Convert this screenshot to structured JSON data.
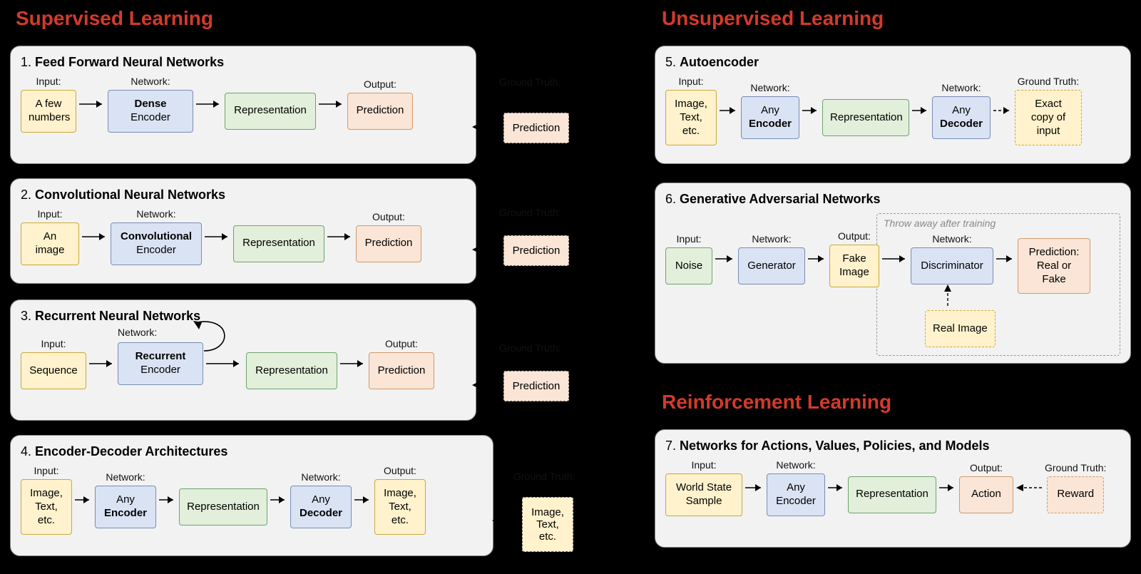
{
  "sections": {
    "supervised": "Supervised Learning",
    "unsupervised": "Unsupervised Learning",
    "reinforcement": "Reinforcement Learning"
  },
  "labels": {
    "input": "Input:",
    "network": "Network:",
    "output": "Output:",
    "ground_truth": "Ground Truth:"
  },
  "panels": {
    "ffnn": {
      "num": "1.",
      "name": "Feed Forward Neural Networks",
      "input": "A few numbers",
      "encoder_top": "Dense",
      "encoder_bot": "Encoder",
      "repr": "Representation",
      "pred": "Prediction",
      "gt": "Prediction"
    },
    "cnn": {
      "num": "2.",
      "name": "Convolutional Neural Networks",
      "input": "An image",
      "encoder_top": "Convolutional",
      "encoder_bot": "Encoder",
      "repr": "Representation",
      "pred": "Prediction",
      "gt": "Prediction"
    },
    "rnn": {
      "num": "3.",
      "name": "Recurrent Neural Networks",
      "input": "Sequence",
      "encoder_top": "Recurrent",
      "encoder_bot": "Encoder",
      "repr": "Representation",
      "pred": "Prediction",
      "gt": "Prediction"
    },
    "encdec": {
      "num": "4.",
      "name": "Encoder-Decoder Architectures",
      "input": "Image, Text, etc.",
      "encoder_top": "Any",
      "encoder_bot": "Encoder",
      "repr": "Representation",
      "decoder_top": "Any",
      "decoder_bot": "Decoder",
      "output": "Image, Text, etc.",
      "gt": "Image, Text, etc."
    },
    "ae": {
      "num": "5.",
      "name": "Autoencoder",
      "input": "Image, Text, etc.",
      "encoder_top": "Any",
      "encoder_bot": "Encoder",
      "repr": "Representation",
      "decoder_top": "Any",
      "decoder_bot": "Decoder",
      "gt": "Exact copy of input"
    },
    "gan": {
      "num": "6.",
      "name": "Generative Adversarial Networks",
      "noise": "Noise",
      "generator": "Generator",
      "fake": "Fake Image",
      "discriminator": "Discriminator",
      "pred": "Prediction: Real or Fake",
      "real": "Real Image",
      "discard": "Throw away after training"
    },
    "rl": {
      "num": "7.",
      "name": "Networks for Actions, Values, Policies, and Models",
      "input": "World State Sample",
      "encoder_top": "Any",
      "encoder_bot": "Encoder",
      "repr": "Representation",
      "action": "Action",
      "reward": "Reward"
    }
  }
}
